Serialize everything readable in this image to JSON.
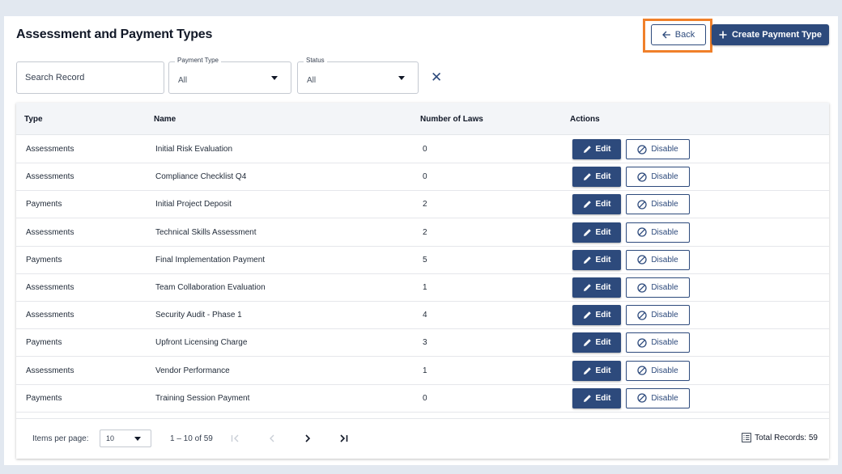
{
  "header": {
    "title": "Assessment and Payment Types",
    "back_label": "Back",
    "create_label": "Create Payment Type"
  },
  "filters": {
    "search_placeholder": "Search Record",
    "payment_type": {
      "label": "Payment Type",
      "value": "All"
    },
    "status": {
      "label": "Status",
      "value": "All"
    }
  },
  "table": {
    "columns": [
      "Type",
      "Name",
      "Number of Laws",
      "Actions"
    ],
    "rows": [
      {
        "type": "Assessments",
        "name": "Initial Risk Evaluation",
        "laws": "0"
      },
      {
        "type": "Assessments",
        "name": "Compliance Checklist Q4",
        "laws": "0"
      },
      {
        "type": "Payments",
        "name": "Initial Project Deposit",
        "laws": "2"
      },
      {
        "type": "Assessments",
        "name": "Technical Skills Assessment",
        "laws": "2"
      },
      {
        "type": "Payments",
        "name": "Final Implementation Payment",
        "laws": "5"
      },
      {
        "type": "Assessments",
        "name": "Team Collaboration Evaluation",
        "laws": "1"
      },
      {
        "type": "Assessments",
        "name": "Security Audit - Phase 1",
        "laws": "4"
      },
      {
        "type": "Payments",
        "name": "Upfront Licensing Charge",
        "laws": "3"
      },
      {
        "type": "Assessments",
        "name": "Vendor Performance",
        "laws": "1"
      },
      {
        "type": "Payments",
        "name": "Training Session Payment",
        "laws": "0"
      }
    ],
    "edit_label": "Edit",
    "disable_label": "Disable"
  },
  "pagination": {
    "items_per_page_label": "Items per page:",
    "items_per_page_value": "10",
    "range_label": "1 – 10 of 59",
    "total_label": "Total Records: 59"
  },
  "colors": {
    "primary": "#2d4a7c",
    "highlight": "#f0802a",
    "background": "#e2e8f0"
  }
}
